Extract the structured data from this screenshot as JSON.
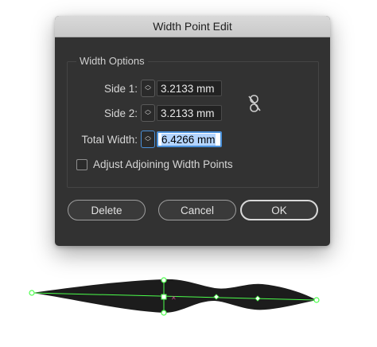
{
  "dialog": {
    "title": "Width Point Edit",
    "group_label": "Width Options",
    "side1": {
      "label": "Side 1:",
      "value": "3.2133 mm"
    },
    "side2": {
      "label": "Side 2:",
      "value": "3.2133 mm"
    },
    "total": {
      "label": "Total Width:",
      "value": "6.4266 mm"
    },
    "adjust": {
      "label": "Adjust Adjoining Width Points",
      "checked": false
    },
    "buttons": {
      "delete": "Delete",
      "cancel": "Cancel",
      "ok": "OK"
    }
  },
  "colors": {
    "dialog_bg": "#323232",
    "path_green": "#4cff4c",
    "stroke_fill": "#1c1c1c",
    "focus_blue": "#4a90d9"
  },
  "icons": {
    "link": "unlink-icon",
    "stepper": "stepper-arrows-icon"
  }
}
